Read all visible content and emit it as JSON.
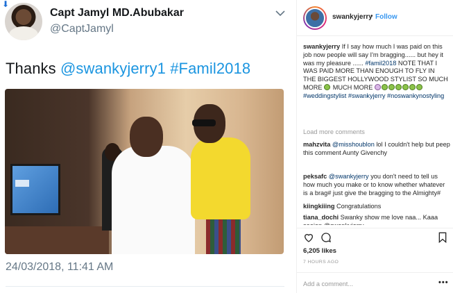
{
  "tweet": {
    "name": "Capt Jamyl MD.Abubakar",
    "handle": "@CaptJamyl",
    "text_plain": "Thanks",
    "mention": "@swankyjerry1",
    "hashtag": "#Famil2018",
    "date": "24/03/2018, 11:41 AM",
    "link_color": "#1b95e0"
  },
  "instagram": {
    "username": "swankyjerry",
    "dot": "•",
    "follow_label": "Follow",
    "caption": {
      "user": "swankyjerry",
      "part1": "If I say how much I was paid on this job now people will say I'm bragging...... but hey it was my pleasure ......",
      "tag1": "#famil2018",
      "part2": "NOTE THAT I WAS PAID MORE THAN ENOUGH TO FLY IN THE BIGGEST HOLLYWOOD STYLIST SO MUCH MORE",
      "part3": "MUCH MORE",
      "tag2": "#weddingstylist",
      "tag3": "#swankyjerry",
      "tag4": "#noswankynostyling"
    },
    "load_more": "Load more comments",
    "comments": [
      {
        "user": "mahzvita",
        "mention": "@misshoublon",
        "text": "lol I couldn't help but peep this comment Aunty Givenchy"
      },
      {
        "user": "peksafc",
        "mention": "@swankyjerry",
        "text": "you don't need to tell us how much you make or to know whether whatever is a brag# just give the bragging to the Almighty#"
      },
      {
        "user": "kiingkiiing",
        "mention": "",
        "text": "Congratulations"
      },
      {
        "user": "tiana_dochi",
        "mention": "",
        "text": "Swanky show me love naa... Kaaa saaian @swankyjerry"
      }
    ],
    "likes": "6,205 likes",
    "time": "7 HOURS AGO",
    "add_comment_placeholder": "Add a comment...",
    "more_label": "•••",
    "follow_color": "#3897f0",
    "hashtag_color": "#003569"
  }
}
